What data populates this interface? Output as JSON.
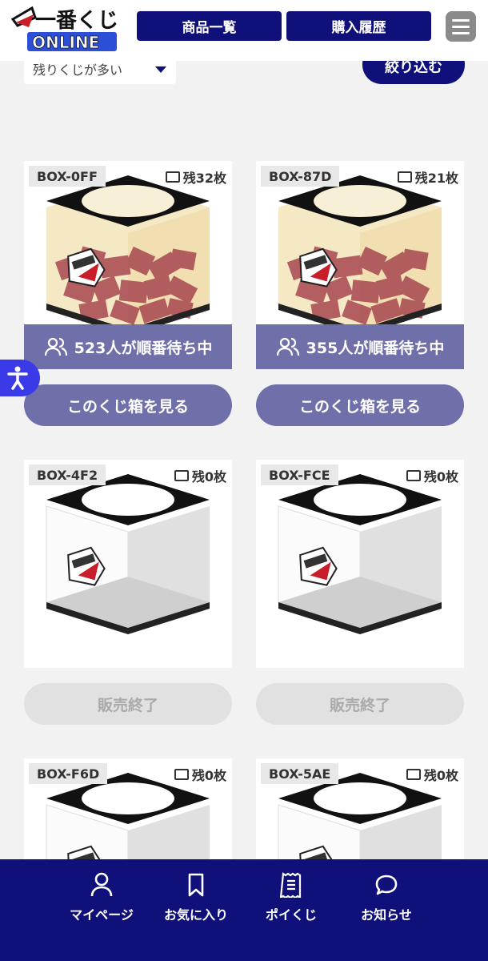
{
  "header": {
    "logo_text_top": "一番くじ",
    "logo_text_bottom": "ONLINE",
    "products_label": "商品一覧",
    "history_label": "購入履歴",
    "menu_icon": "hamburger-icon"
  },
  "filter": {
    "sort_value": "残りくじが多い",
    "filter_label": "絞り込む"
  },
  "boxes": [
    {
      "id": "BOX-0FF",
      "remaining": "残32枚",
      "queue": "523人が順番待ち中",
      "action": "このくじ箱を見る",
      "status": "active"
    },
    {
      "id": "BOX-87D",
      "remaining": "残21枚",
      "queue": "355人が順番待ち中",
      "action": "このくじ箱を見る",
      "status": "active"
    },
    {
      "id": "BOX-4F2",
      "remaining": "残0枚",
      "action": "販売終了",
      "status": "ended"
    },
    {
      "id": "BOX-FCE",
      "remaining": "残0枚",
      "action": "販売終了",
      "status": "ended"
    },
    {
      "id": "BOX-F6D",
      "remaining": "残0枚",
      "status": "ended"
    },
    {
      "id": "BOX-5AE",
      "remaining": "残0枚",
      "status": "ended"
    }
  ],
  "bottom_nav": [
    {
      "label": "マイページ",
      "icon": "user-icon"
    },
    {
      "label": "お気に入り",
      "icon": "bookmark-icon"
    },
    {
      "label": "ポイくじ",
      "icon": "receipt-icon"
    },
    {
      "label": "お知らせ",
      "icon": "chat-bubble-icon"
    }
  ],
  "colors": {
    "navy": "#10107a",
    "purple": "#6f6fa9",
    "ended_gray": "#e1e1e1",
    "a11y_blue": "#3a3ae8"
  }
}
